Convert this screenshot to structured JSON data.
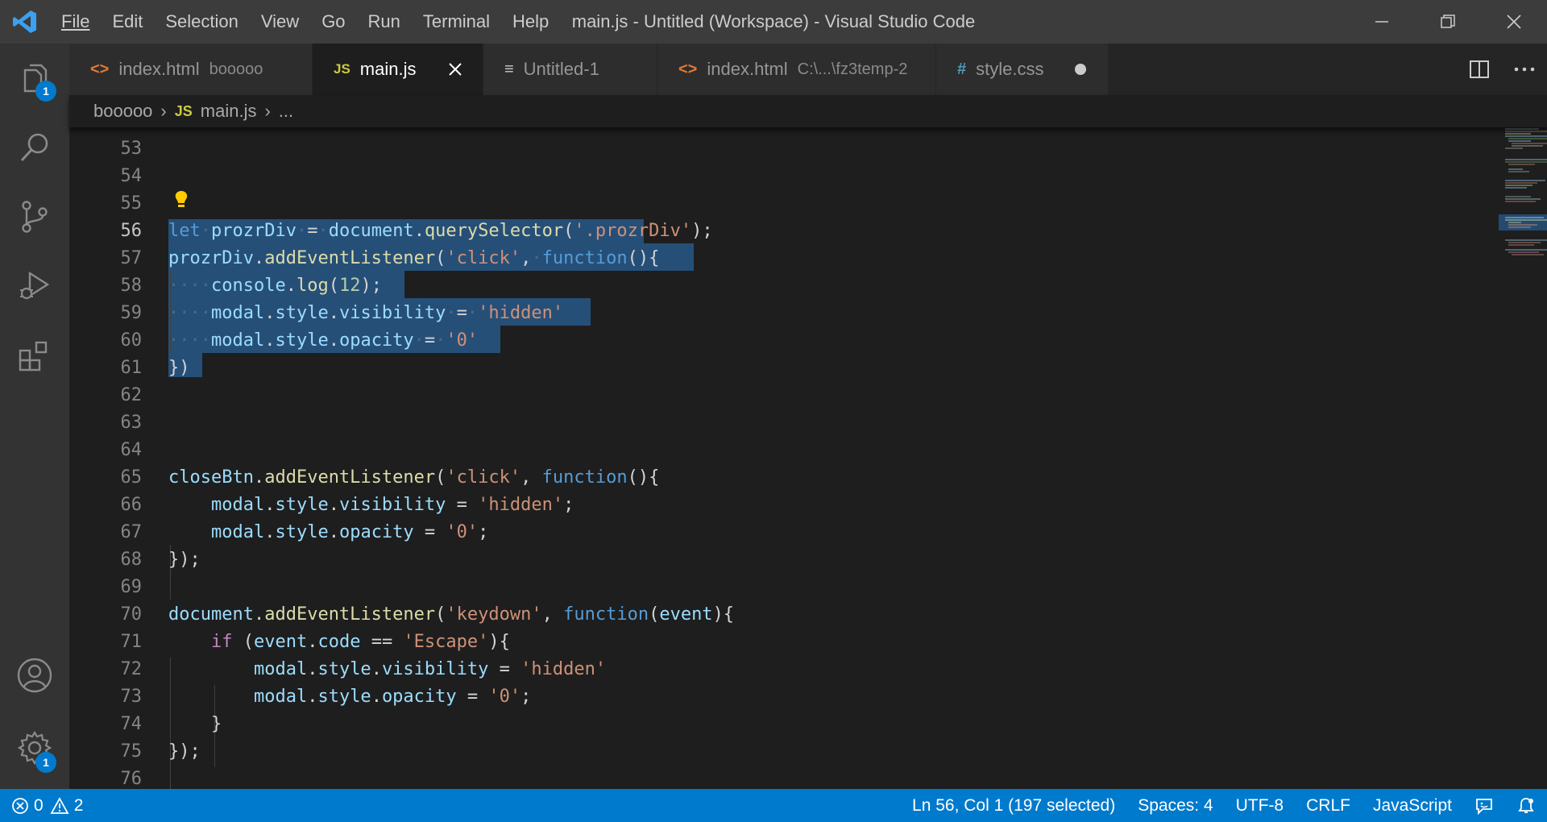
{
  "window": {
    "title": "main.js - Untitled (Workspace) - Visual Studio Code"
  },
  "menu": [
    {
      "label": "File"
    },
    {
      "label": "Edit"
    },
    {
      "label": "Selection"
    },
    {
      "label": "View"
    },
    {
      "label": "Go"
    },
    {
      "label": "Run"
    },
    {
      "label": "Terminal"
    },
    {
      "label": "Help"
    }
  ],
  "activity_bar": {
    "explorer_badge": "1",
    "manage_badge": "1",
    "items": [
      "files-icon",
      "search-icon",
      "source-control-icon",
      "run-debug-icon",
      "extensions-icon",
      "account-icon",
      "gear-icon"
    ]
  },
  "tabs": [
    {
      "icon": "<>",
      "label": "index.html",
      "description": "booooo"
    },
    {
      "icon": "JS",
      "label": "main.js",
      "description": ""
    },
    {
      "icon": "≡",
      "label": "Untitled-1",
      "description": ""
    },
    {
      "icon": "<>",
      "label": "index.html",
      "description": "C:\\...\\fz3temp-2"
    },
    {
      "icon": "#",
      "label": "style.css",
      "description": ""
    }
  ],
  "breadcrumb": {
    "folder": "booooo",
    "file_icon": "JS",
    "file": "main.js",
    "symbol": "..."
  },
  "editor": {
    "first_partial_line": "52",
    "current_line": "56",
    "line_numbers": [
      "53",
      "54",
      "55",
      "56",
      "57",
      "58",
      "59",
      "60",
      "61",
      "62",
      "63",
      "64",
      "65",
      "66",
      "67",
      "68",
      "69",
      "70",
      "71",
      "72",
      "73",
      "74",
      "75",
      "76"
    ]
  },
  "status_bar": {
    "errors": "0",
    "warnings": "2",
    "position": "Ln 56, Col 1 (197 selected)",
    "spaces": "Spaces: 4",
    "encoding": "UTF-8",
    "eol": "CRLF",
    "language": "JavaScript"
  },
  "colors": {
    "accent": "#007acc",
    "selection": "#264f78",
    "keyword": "#569cd6",
    "string": "#ce9178",
    "function": "#dcdcaa",
    "variable": "#9cdcfe"
  }
}
